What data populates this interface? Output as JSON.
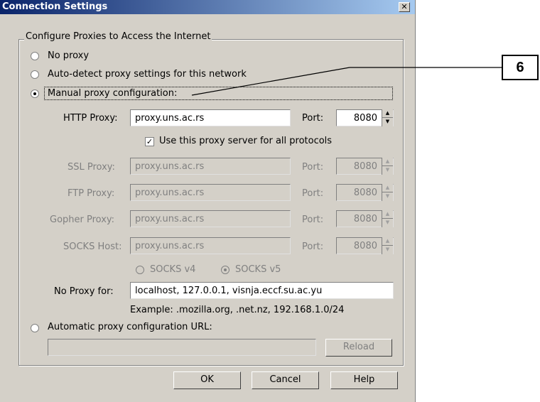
{
  "window": {
    "title": "Connection Settings",
    "close_label": "✕"
  },
  "group": {
    "legend": "Configure Proxies to Access the Internet"
  },
  "radios": {
    "no_proxy": "No proxy",
    "auto_detect": "Auto-detect proxy settings for this network",
    "manual": "Manual proxy configuration:",
    "auto_url": "Automatic proxy configuration URL:"
  },
  "http": {
    "label": "HTTP Proxy:",
    "value": "proxy.uns.ac.rs",
    "port_label": "Port:",
    "port_value": "8080"
  },
  "use_all": {
    "label": "Use this proxy server for all protocols",
    "checkmark": "✓"
  },
  "ssl": {
    "label": "SSL Proxy:",
    "value": "proxy.uns.ac.rs",
    "port_label": "Port:",
    "port_value": "8080"
  },
  "ftp": {
    "label": "FTP Proxy:",
    "value": "proxy.uns.ac.rs",
    "port_label": "Port:",
    "port_value": "8080"
  },
  "gopher": {
    "label": "Gopher Proxy:",
    "value": "proxy.uns.ac.rs",
    "port_label": "Port:",
    "port_value": "8080"
  },
  "socks": {
    "label": "SOCKS Host:",
    "value": "proxy.uns.ac.rs",
    "port_label": "Port:",
    "port_value": "8080"
  },
  "socks_version": {
    "v4": "SOCKS v4",
    "v5": "SOCKS v5"
  },
  "no_proxy_for": {
    "label": "No Proxy for:",
    "value": "localhost, 127.0.0.1, visnja.eccf.su.ac.yu",
    "example": "Example: .mozilla.org, .net.nz, 192.168.1.0/24"
  },
  "auto_url": {
    "value": "",
    "reload_label": "Reload"
  },
  "buttons": {
    "ok": "OK",
    "cancel": "Cancel",
    "help": "Help"
  },
  "spin": {
    "up": "▲",
    "down": "▼"
  },
  "annotation": {
    "number": "6"
  }
}
